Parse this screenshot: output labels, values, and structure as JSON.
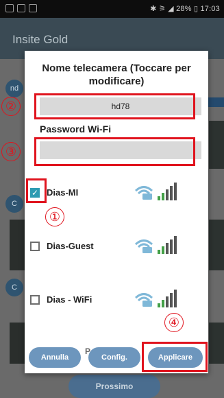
{
  "status_bar": {
    "right_text": "✱ ⚞ ◢ 28% ▯ 17:03"
  },
  "app": {
    "title": "Insite Gold",
    "bg_circle_1": "nd",
    "bg_circle_2": "C",
    "bg_circle_3": "C",
    "next_button": "Prossimo"
  },
  "dialog": {
    "title": "Nome telecamera (Toccare per modificare)",
    "camera_name_value": "hd78",
    "password_label": "Password Wi-Fi",
    "password_value": "",
    "networks": [
      {
        "ssid": "Dias-MI",
        "checked": true,
        "icon": "wifi-lock-icon"
      },
      {
        "ssid": "Dias-Guest",
        "checked": false,
        "icon": "wifi-lock-icon"
      },
      {
        "ssid": "Dias - WiFi",
        "checked": false,
        "icon": "wifi-lock-icon"
      }
    ],
    "partial_row_text": "P",
    "buttons": {
      "cancel": "Annulla",
      "config": "Config.",
      "apply": "Applicare"
    }
  },
  "annotations": {
    "one": "①",
    "two": "②",
    "three": "③",
    "four": "④"
  },
  "colors": {
    "accent": "#6d96bd",
    "checkbox": "#2e9bb2",
    "annotation": "#e0141e"
  }
}
